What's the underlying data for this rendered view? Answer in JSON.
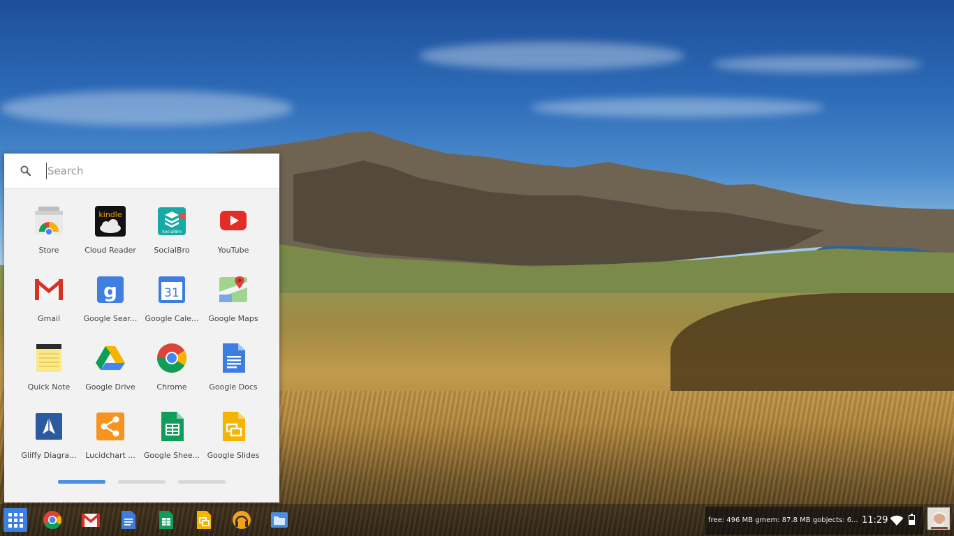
{
  "search": {
    "placeholder": "Search"
  },
  "apps": [
    {
      "label": "Store",
      "icon": "store-icon"
    },
    {
      "label": "Cloud Reader",
      "icon": "kindle-icon",
      "icon_text": "kindle"
    },
    {
      "label": "SocialBro",
      "icon": "socialbro-icon",
      "icon_text": "SocialBro"
    },
    {
      "label": "YouTube",
      "icon": "youtube-icon"
    },
    {
      "label": "Gmail",
      "icon": "gmail-icon"
    },
    {
      "label": "Google Sear...",
      "icon": "google-search-icon",
      "icon_text": "g"
    },
    {
      "label": "Google Cale...",
      "icon": "google-calendar-icon",
      "icon_text": "31"
    },
    {
      "label": "Google Maps",
      "icon": "google-maps-icon"
    },
    {
      "label": "Quick Note",
      "icon": "quick-note-icon"
    },
    {
      "label": "Google Drive",
      "icon": "google-drive-icon"
    },
    {
      "label": "Chrome",
      "icon": "chrome-icon"
    },
    {
      "label": "Google Docs",
      "icon": "google-docs-icon"
    },
    {
      "label": "Gliffy Diagra...",
      "icon": "gliffy-icon"
    },
    {
      "label": "Lucidchart ...",
      "icon": "lucidchart-icon"
    },
    {
      "label": "Google Shee...",
      "icon": "google-sheets-icon"
    },
    {
      "label": "Google Slides",
      "icon": "google-slides-icon"
    }
  ],
  "pager": {
    "pages": 3,
    "active_page": 1
  },
  "shelf": {
    "apps": [
      "chrome-icon",
      "gmail-icon",
      "google-docs-icon",
      "google-sheets-icon",
      "google-slides-icon",
      "google-play-music-icon",
      "files-icon"
    ]
  },
  "status": {
    "memory": "free: 496 MB  gmem: 87.8 MB  gobjects: 6...",
    "clock": "11:29",
    "battery_level": 0.5
  },
  "colors": {
    "accent": "#4a8fe7",
    "launcher_button": "#3b7fe0",
    "panel_background": "#f2f2f2"
  }
}
